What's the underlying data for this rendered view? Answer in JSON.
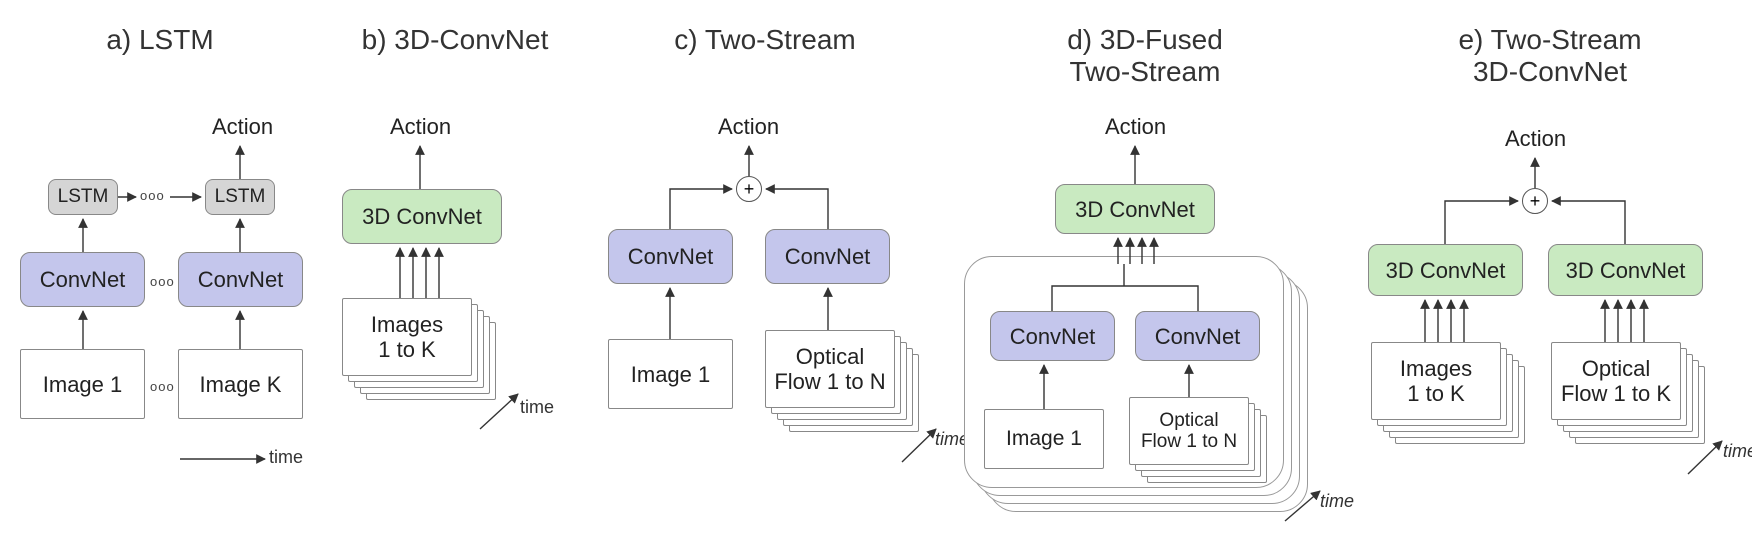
{
  "panels": {
    "a": {
      "title": "a) LSTM",
      "action": "Action",
      "lstm": "LSTM",
      "convnet": "ConvNet",
      "image1": "Image 1",
      "imageK": "Image K",
      "ooo": "ooo",
      "time": "time"
    },
    "b": {
      "title": "b) 3D-ConvNet",
      "action": "Action",
      "conv3d": "3D ConvNet",
      "images": "Images\n1 to K",
      "time": "time"
    },
    "c": {
      "title": "c) Two-Stream",
      "action": "Action",
      "convnet": "ConvNet",
      "image1": "Image 1",
      "flow": "Optical\nFlow 1 to N",
      "plus": "+",
      "time": "time"
    },
    "d": {
      "title": "d) 3D-Fused\nTwo-Stream",
      "action": "Action",
      "conv3d": "3D ConvNet",
      "convnet": "ConvNet",
      "image1": "Image 1",
      "flow": "Optical\nFlow 1 to N",
      "time": "time"
    },
    "e": {
      "title": "e) Two-Stream\n3D-ConvNet",
      "action": "Action",
      "conv3d": "3D ConvNet",
      "images": "Images\n1 to K",
      "flow": "Optical\nFlow 1 to K",
      "plus": "+",
      "time": "time"
    }
  }
}
